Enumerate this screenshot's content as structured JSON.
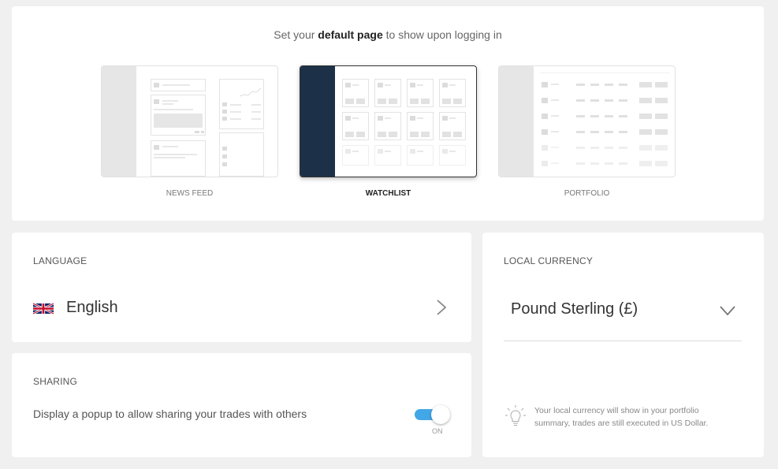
{
  "default_page": {
    "title_prefix": "Set your ",
    "title_bold": "default page",
    "title_suffix": " to show upon logging in",
    "options": [
      {
        "label": "NEWS FEED",
        "selected": false
      },
      {
        "label": "WATCHLIST",
        "selected": true
      },
      {
        "label": "PORTFOLIO",
        "selected": false
      }
    ]
  },
  "language": {
    "section_label": "LANGUAGE",
    "value": "English",
    "flag_icon": "uk-flag-icon",
    "chevron_icon": "chevron-right-icon"
  },
  "sharing": {
    "section_label": "SHARING",
    "description": "Display a popup to allow sharing your trades with others",
    "toggle_on": true,
    "toggle_state_label": "ON",
    "toggle_color": "#42a7e6"
  },
  "currency": {
    "section_label": "LOCAL CURRENCY",
    "value": "Pound Sterling (£)",
    "chevron_icon": "chevron-down-icon",
    "info_icon": "lightbulb-icon",
    "note": "Your local currency will show in your portfolio summary, trades are still executed in US Dollar."
  },
  "colors": {
    "accent": "#42a7e6",
    "watchlist_sidebar": "#1c3148",
    "background": "#f0f0f0"
  }
}
